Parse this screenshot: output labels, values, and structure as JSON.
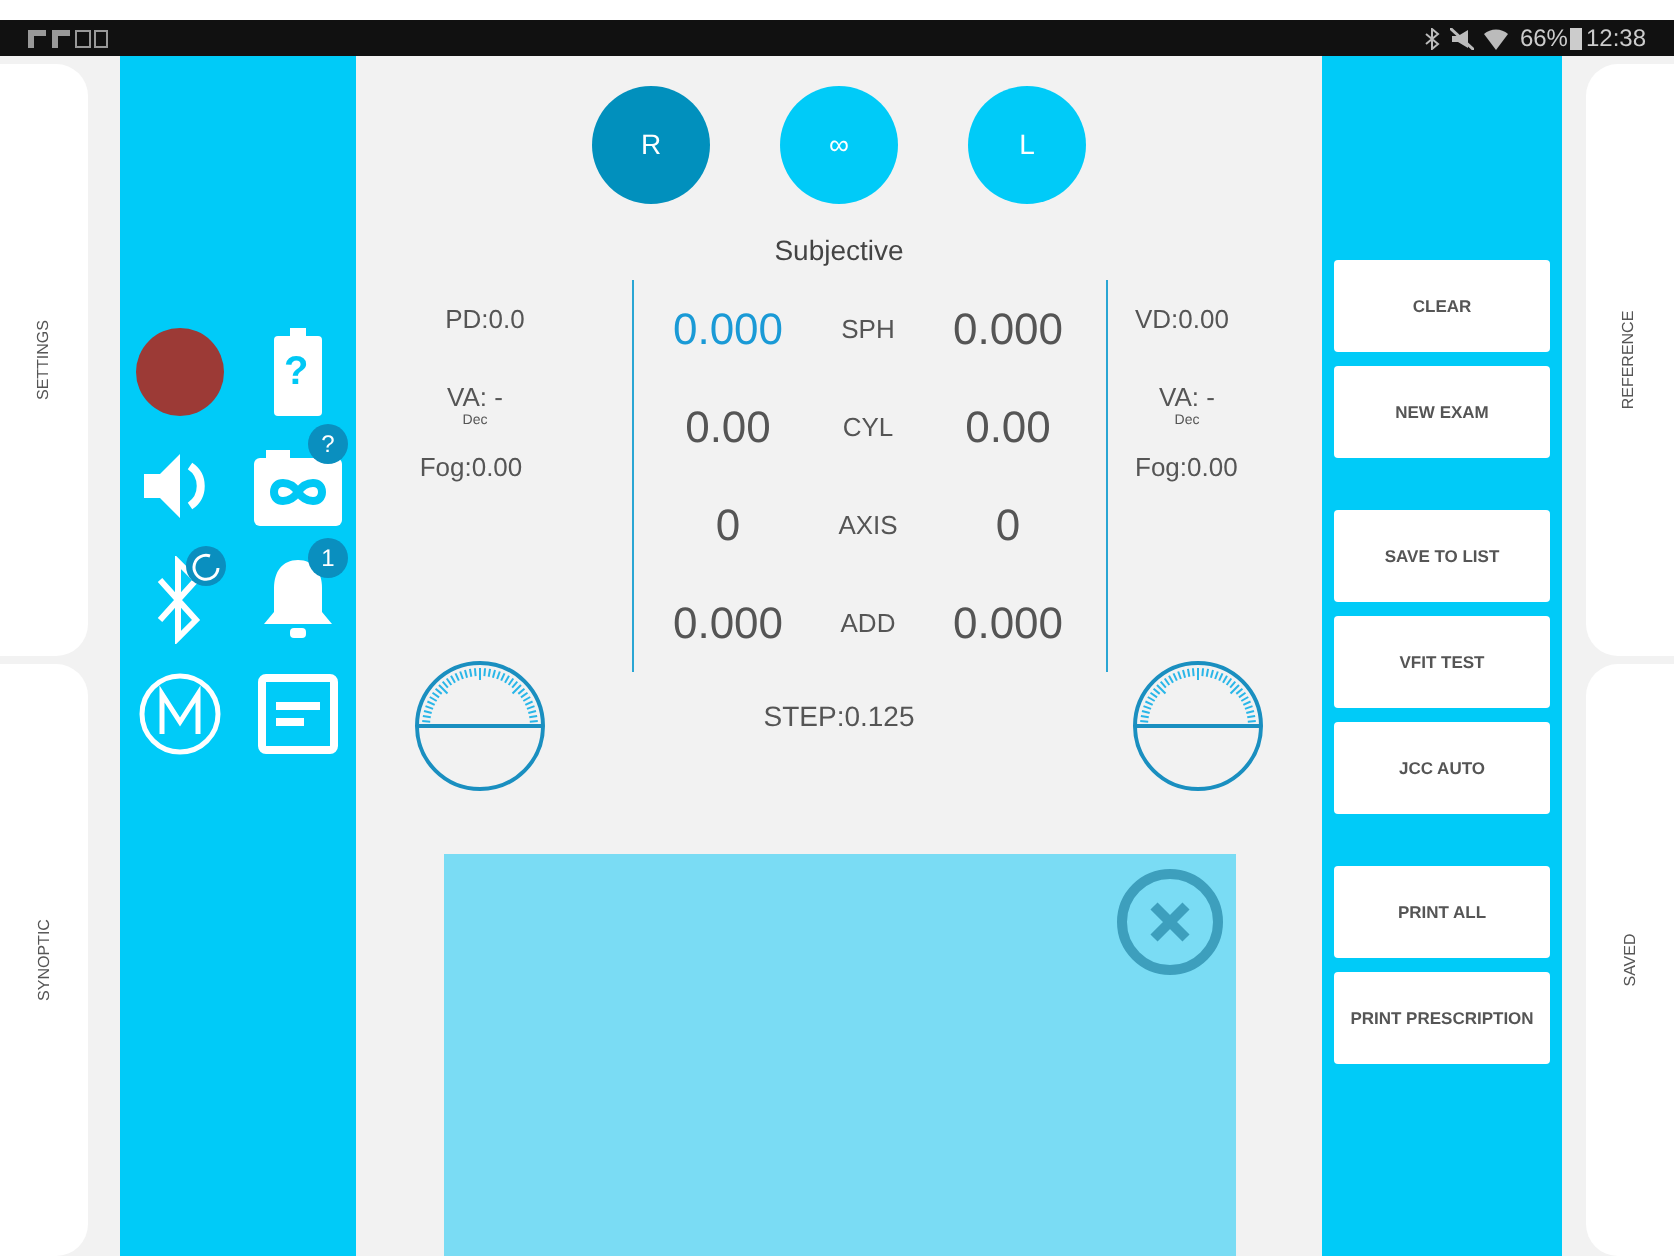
{
  "status_bar": {
    "battery": "66%",
    "time": "12:38"
  },
  "left_tabs": [
    "SETTINGS",
    "SYNOPTIC"
  ],
  "right_tabs": [
    "REFERENCE",
    "SAVED"
  ],
  "tools": [
    {
      "kind": "record"
    },
    {
      "kind": "battery",
      "badge": "?"
    },
    {
      "kind": "speaker"
    },
    {
      "kind": "camera",
      "badge": "?"
    },
    {
      "kind": "bluetooth",
      "busy": true
    },
    {
      "kind": "bell",
      "badge": "1"
    },
    {
      "kind": "m"
    },
    {
      "kind": "note"
    }
  ],
  "eye_selector": [
    {
      "label": "R",
      "selected": true
    },
    {
      "label": "∞",
      "selected": false
    },
    {
      "label": "L",
      "selected": false
    }
  ],
  "mode_title": "Subjective",
  "left_info": {
    "pd": "PD:0.0",
    "va": "VA: -",
    "va_unit": "Dec",
    "fog": "Fog:0.00"
  },
  "right_info": {
    "vd": "VD:0.00",
    "va": "VA: -",
    "va_unit": "Dec",
    "fog": "Fog:0.00"
  },
  "rows": [
    {
      "label": "SPH",
      "right": {
        "value": "0.000",
        "selected": true
      },
      "left": {
        "value": "0.000",
        "selected": false
      }
    },
    {
      "label": "CYL",
      "right": {
        "value": "0.00",
        "selected": false
      },
      "left": {
        "value": "0.00",
        "selected": false
      }
    },
    {
      "label": "AXIS",
      "right": {
        "value": "0",
        "selected": false
      },
      "left": {
        "value": "0",
        "selected": false
      }
    },
    {
      "label": "ADD",
      "right": {
        "value": "0.000",
        "selected": false
      },
      "left": {
        "value": "0.000",
        "selected": false
      }
    }
  ],
  "step": "STEP:0.125",
  "button_groups": [
    [
      "CLEAR",
      "NEW EXAM"
    ],
    [
      "SAVE TO LIST",
      "VFIT TEST",
      "JCC AUTO"
    ],
    [
      "PRINT ALL",
      "PRINT PRESCRIPTION"
    ]
  ]
}
